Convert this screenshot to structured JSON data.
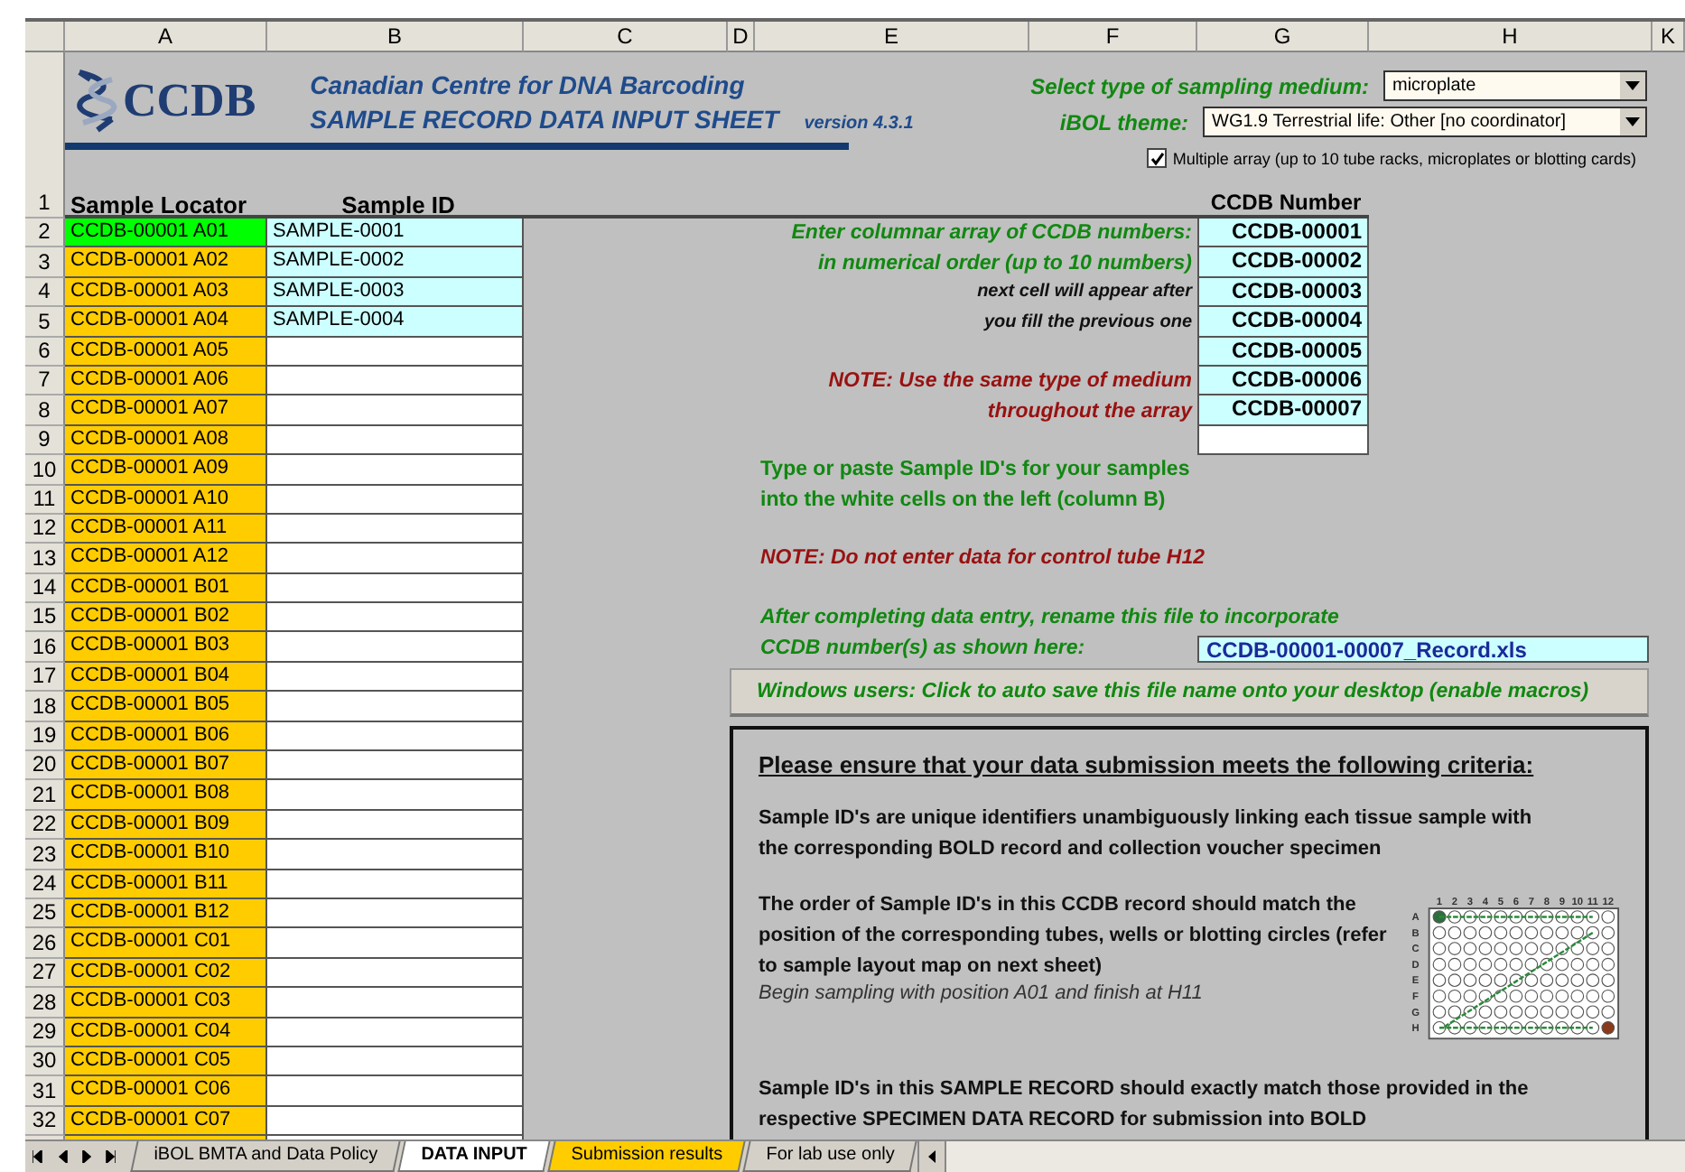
{
  "columns": [
    "A",
    "B",
    "C",
    "D",
    "E",
    "F",
    "G",
    "H",
    "K"
  ],
  "header": {
    "logo_text": "CCDB",
    "title": "Canadian Centre for DNA Barcoding",
    "subtitle": "SAMPLE RECORD DATA INPUT SHEET",
    "version": "version 4.3.1"
  },
  "medium": {
    "label": "Select type of sampling medium:",
    "value": "microplate"
  },
  "theme": {
    "label": "iBOL theme:",
    "value": "WG1.9 Terrestrial life: Other [no coordinator]"
  },
  "multiple_array": {
    "label": "Multiple array (up to 10 tube racks, microplates or blotting cards)",
    "checked": true
  },
  "row1": {
    "number": "1",
    "locator_heading": "Sample Locator",
    "sample_id_heading": "Sample ID",
    "ccdb_heading": "CCDB Number"
  },
  "rows": [
    {
      "number": "2",
      "locator": "CCDB-00001 A01",
      "sample_id": "SAMPLE-0001",
      "selected": true
    },
    {
      "number": "3",
      "locator": "CCDB-00001 A02",
      "sample_id": "SAMPLE-0002",
      "selected": false
    },
    {
      "number": "4",
      "locator": "CCDB-00001 A03",
      "sample_id": "SAMPLE-0003",
      "selected": false
    },
    {
      "number": "5",
      "locator": "CCDB-00001 A04",
      "sample_id": "SAMPLE-0004",
      "selected": false
    },
    {
      "number": "6",
      "locator": "CCDB-00001 A05",
      "selected": false
    },
    {
      "number": "7",
      "locator": "CCDB-00001 A06",
      "selected": false
    },
    {
      "number": "8",
      "locator": "CCDB-00001 A07",
      "selected": false
    },
    {
      "number": "9",
      "locator": "CCDB-00001 A08",
      "selected": false
    },
    {
      "number": "10",
      "locator": "CCDB-00001 A09",
      "selected": false
    },
    {
      "number": "11",
      "locator": "CCDB-00001 A10",
      "selected": false
    },
    {
      "number": "12",
      "locator": "CCDB-00001 A11",
      "selected": false
    },
    {
      "number": "13",
      "locator": "CCDB-00001 A12",
      "selected": false
    },
    {
      "number": "14",
      "locator": "CCDB-00001 B01",
      "selected": false
    },
    {
      "number": "15",
      "locator": "CCDB-00001 B02",
      "selected": false
    },
    {
      "number": "16",
      "locator": "CCDB-00001 B03",
      "selected": false
    },
    {
      "number": "17",
      "locator": "CCDB-00001 B04",
      "selected": false
    },
    {
      "number": "18",
      "locator": "CCDB-00001 B05",
      "selected": false
    },
    {
      "number": "19",
      "locator": "CCDB-00001 B06",
      "selected": false
    },
    {
      "number": "20",
      "locator": "CCDB-00001 B07",
      "selected": false
    },
    {
      "number": "21",
      "locator": "CCDB-00001 B08",
      "selected": false
    },
    {
      "number": "22",
      "locator": "CCDB-00001 B09",
      "selected": false
    },
    {
      "number": "23",
      "locator": "CCDB-00001 B10",
      "selected": false
    },
    {
      "number": "24",
      "locator": "CCDB-00001 B11",
      "selected": false
    },
    {
      "number": "25",
      "locator": "CCDB-00001 B12",
      "selected": false
    },
    {
      "number": "26",
      "locator": "CCDB-00001 C01",
      "selected": false
    },
    {
      "number": "27",
      "locator": "CCDB-00001 C02",
      "selected": false
    },
    {
      "number": "28",
      "locator": "CCDB-00001 C03",
      "selected": false
    },
    {
      "number": "29",
      "locator": "CCDB-00001 C04",
      "selected": false
    },
    {
      "number": "30",
      "locator": "CCDB-00001 C05",
      "selected": false
    },
    {
      "number": "31",
      "locator": "CCDB-00001 C06",
      "selected": false
    },
    {
      "number": "32",
      "locator": "CCDB-00001 C07",
      "selected": false
    }
  ],
  "ccdb_numbers": [
    "CCDB-00001",
    "CCDB-00002",
    "CCDB-00003",
    "CCDB-00004",
    "CCDB-00005",
    "CCDB-00006",
    "CCDB-00007"
  ],
  "array_notes": [
    {
      "text": "Enter columnar array of CCDB numbers:",
      "kind": "instruction"
    },
    {
      "text": "in numerical order (up to 10 numbers)",
      "kind": "instruction"
    },
    {
      "text": "next cell will appear after",
      "kind": "hint"
    },
    {
      "text": "you fill the previous one",
      "kind": "hint"
    }
  ],
  "medium_note": [
    {
      "text": "NOTE: Use the same type of medium",
      "kind": "warning"
    },
    {
      "text": "throughout the array",
      "kind": "warning"
    }
  ],
  "sample_id_note": [
    "Type or paste Sample ID's for your samples",
    "into the white cells on the left (column B)"
  ],
  "control_note": "NOTE: Do not enter data for control tube H12",
  "rename_note": [
    "After completing data entry, rename this file to incorporate",
    "CCDB number(s) as shown here:"
  ],
  "file_name": "CCDB-00001-00007_Record.xls",
  "save_button": "Windows users: Click to auto save this file name onto your desktop (enable macros)",
  "criteria": {
    "heading": "Please ensure that your data submission meets the following criteria:",
    "unique": "Sample ID's are unique identifiers unambiguously linking each tissue sample with the corresponding BOLD record and collection voucher specimen",
    "order": "The order of Sample ID's in this CCDB record should match the position of the corresponding tubes, wells or blotting circles (refer to sample layout map on next sheet)",
    "begin": "Begin sampling with position A01 and finish at H11",
    "match": "Sample ID's in this SAMPLE RECORD should exactly match those provided in the respective SPECIMEN DATA RECORD for submission into BOLD",
    "plate_columns": [
      "1",
      "2",
      "3",
      "4",
      "5",
      "6",
      "7",
      "8",
      "9",
      "10",
      "11",
      "12"
    ],
    "plate_rows": [
      "A",
      "B",
      "C",
      "D",
      "E",
      "F",
      "G",
      "H"
    ]
  },
  "sheet_tabs": [
    {
      "label": "iBOL BMTA and Data Policy",
      "selected": false,
      "color": "#d4d0c8"
    },
    {
      "label": "DATA INPUT",
      "selected": true,
      "color": "#ffffff"
    },
    {
      "label": "Submission results",
      "selected": false,
      "color": "#ffcc00"
    },
    {
      "label": "For lab use only",
      "selected": false,
      "color": "#d4d0c8"
    }
  ]
}
